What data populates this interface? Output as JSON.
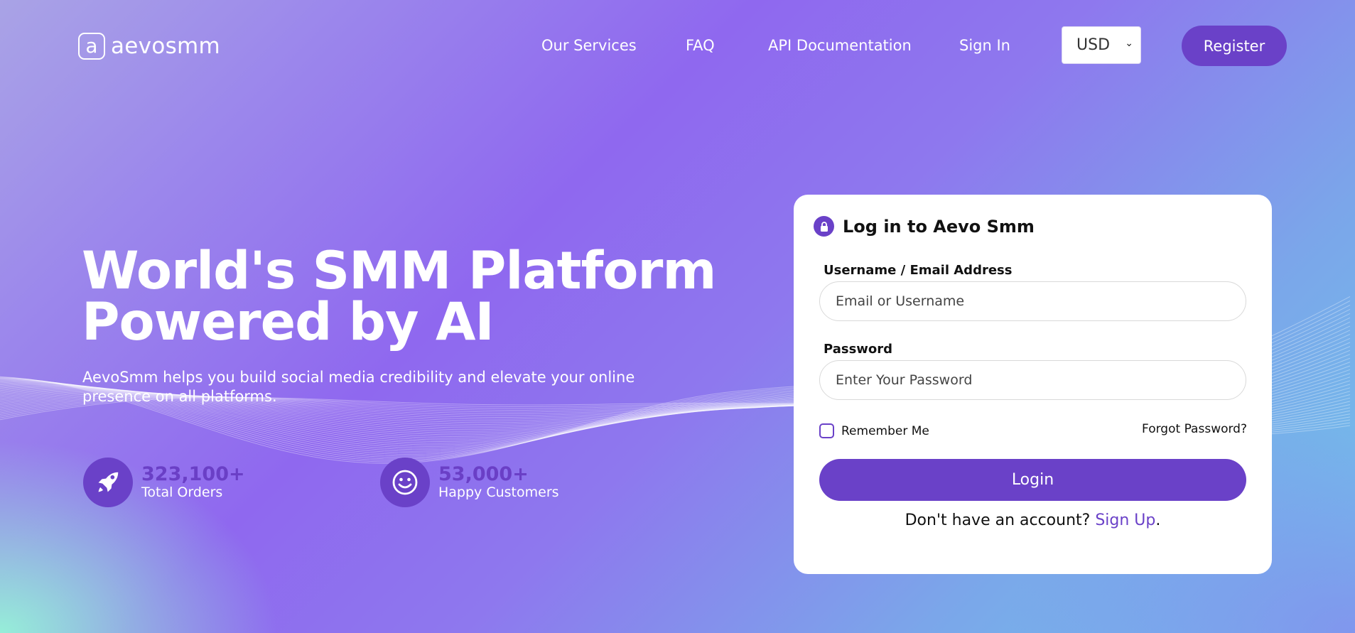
{
  "brand": {
    "name": "aevosmm",
    "mark": "a"
  },
  "nav": {
    "services": "Our Services",
    "faq": "FAQ",
    "api": "API Documentation",
    "signin": "Sign In",
    "currency": "USD",
    "register": "Register"
  },
  "hero": {
    "title_line1": "World's SMM Platform",
    "title_line2": "Powered by AI",
    "subtitle_line1": "AevoSmm helps you build social media credibility and elevate your online",
    "subtitle_line2": "presence on all platforms."
  },
  "stats": [
    {
      "value": "323,100+",
      "label": "Total Orders",
      "icon": "rocket-icon"
    },
    {
      "value": "53,000+",
      "label": "Happy Customers",
      "icon": "smiley-icon"
    }
  ],
  "login": {
    "title": "Log in to Aevo Smm",
    "username_label": "Username / Email Address",
    "username_placeholder": "Email or Username",
    "password_label": "Password",
    "password_placeholder": "Enter Your Password",
    "remember": "Remember Me",
    "forgot": "Forgot Password?",
    "button": "Login",
    "no_account": "Don't have an account? ",
    "signup": "Sign Up",
    "period": "."
  },
  "colors": {
    "accent": "#6a41c8",
    "mint": "#96f5d7",
    "lavender": "#8f68ef",
    "sky": "#6fc4ea"
  }
}
